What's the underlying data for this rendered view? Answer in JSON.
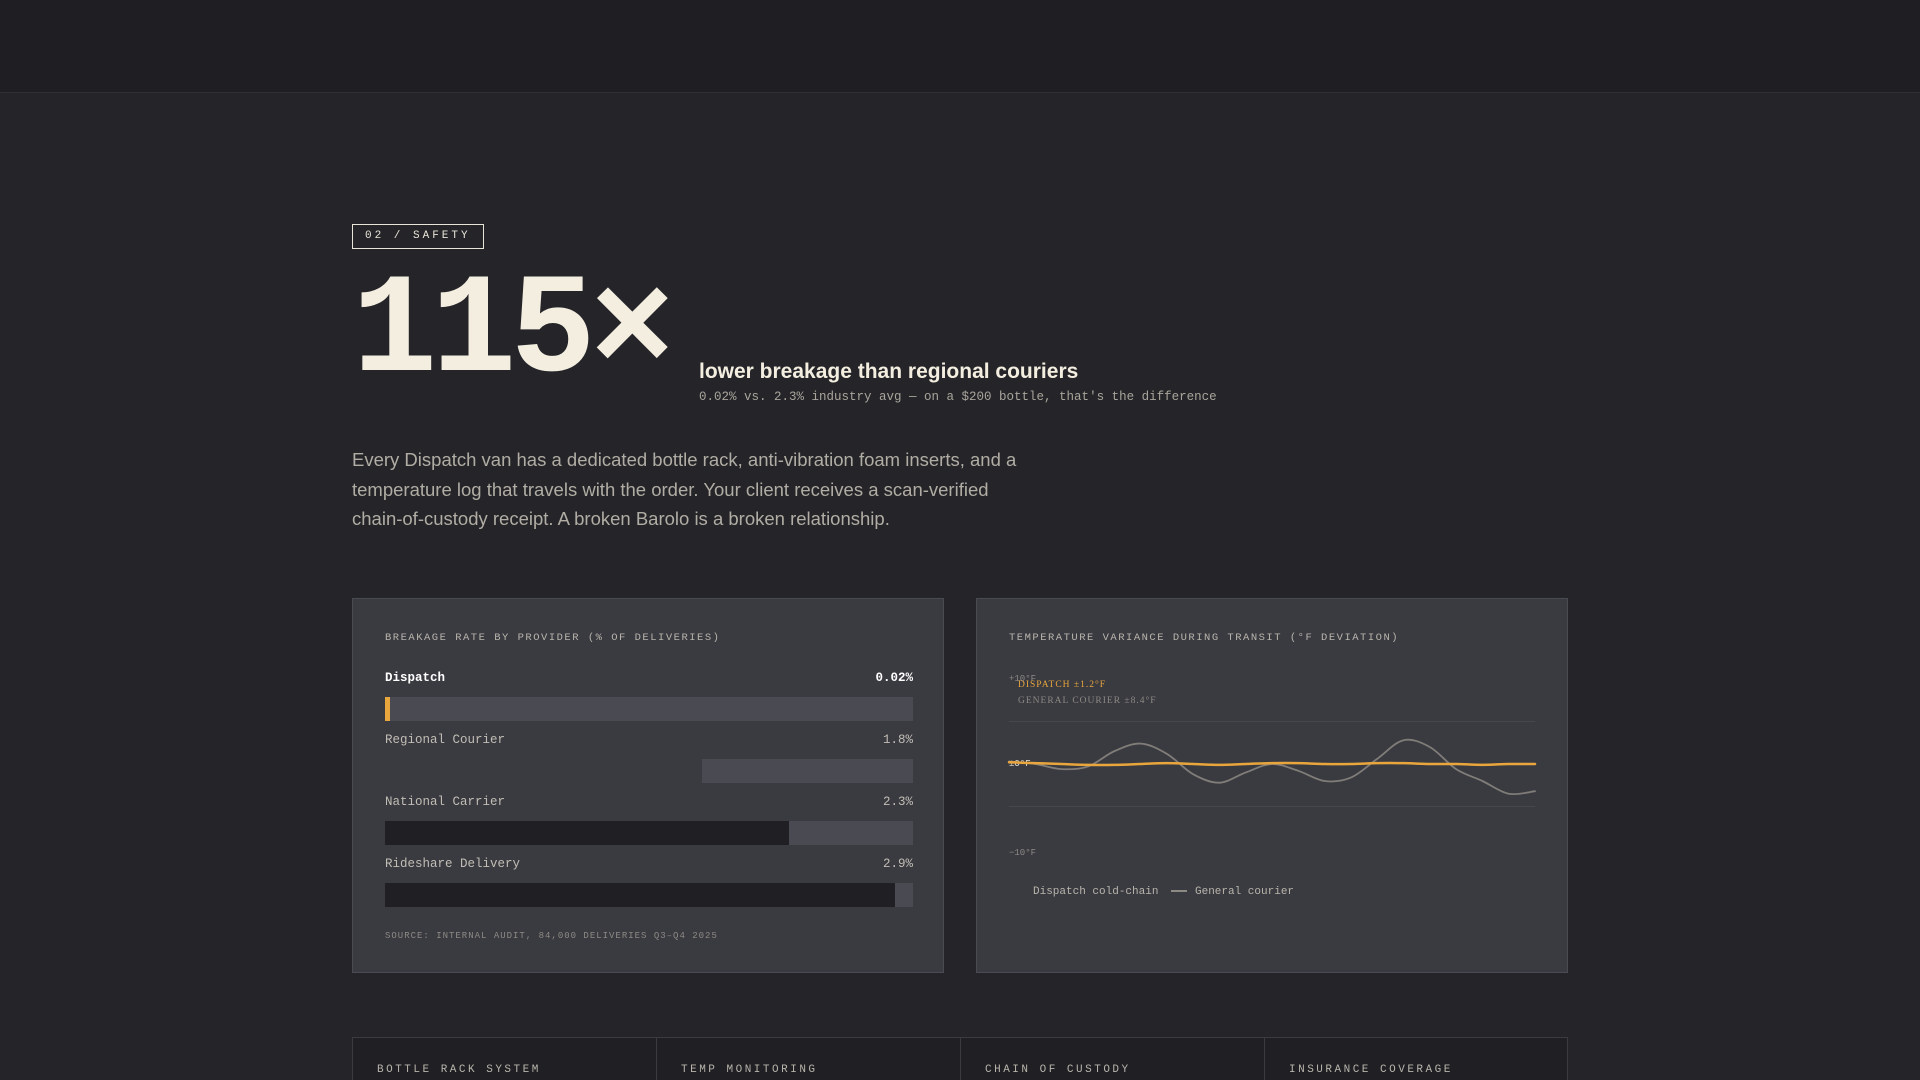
{
  "section": {
    "tag": "02 / SAFETY"
  },
  "headline": {
    "number": "115×",
    "subtitle": "lower breakage than regional couriers",
    "note": "0.02% vs. 2.3% industry avg — on a $200 bottle, that's the difference"
  },
  "intro": "Every Dispatch van has a dedicated bottle rack, anti-vibration foam inserts, and a temperature log that travels with the order. Your client receives a scan-verified chain-of-custody receipt. A broken Barolo is a broken relationship.",
  "breakage_card": {
    "title": "BREAKAGE RATE BY PROVIDER (% OF DELIVERIES)",
    "source": "SOURCE: INTERNAL AUDIT, 84,000 DELIVERIES Q3–Q4 2025",
    "rows": [
      {
        "label": "Dispatch",
        "value_label": "0.02%",
        "fill": 0.01,
        "align": "left"
      },
      {
        "label": "Regional Courier",
        "value_label": "1.8%",
        "fill": 0.6,
        "align": "none"
      },
      {
        "label": "National Carrier",
        "value_label": "2.3%",
        "fill": 0.766,
        "align": "left"
      },
      {
        "label": "Rideshare Delivery",
        "value_label": "2.9%",
        "fill": 0.966,
        "align": "left"
      }
    ]
  },
  "temperature_card": {
    "title": "TEMPERATURE VARIANCE DURING TRANSIT (°F DEVIATION)",
    "legend": [
      {
        "label": "Dispatch cold-chain",
        "color": "#e9a63c"
      },
      {
        "label": "General courier",
        "color": "#8d8a83"
      }
    ]
  },
  "chart_data": {
    "type": "line",
    "title": "TEMPERATURE VARIANCE DURING TRANSIT (°F DEVIATION)",
    "ylim": [
      -10,
      10
    ],
    "y_ticks": [
      "+10°F",
      "±0°F",
      "−10°F"
    ],
    "annotations": [
      "DISPATCH ±1.2°F",
      "GENERAL COURIER ±8.4°F"
    ],
    "x": [
      0,
      1,
      2,
      3,
      4,
      5,
      6,
      7,
      8,
      9,
      10,
      11,
      12,
      13,
      14,
      15,
      16,
      17,
      18,
      19,
      20
    ],
    "series": [
      {
        "name": "Dispatch cold-chain",
        "color": "#e9a63c",
        "values": [
          0.2,
          0.1,
          0,
          -0.1,
          -0.1,
          0,
          0.1,
          0,
          -0.1,
          0,
          0.1,
          0.1,
          0,
          0,
          0.1,
          0.1,
          0,
          0,
          -0.1,
          0,
          0
        ]
      },
      {
        "name": "General courier",
        "color": "#8d8a83",
        "values": [
          0.3,
          0,
          -0.6,
          -0.3,
          1.5,
          2.4,
          1.2,
          -1.2,
          -2.2,
          -1.0,
          0,
          -0.8,
          -2.0,
          -1.6,
          0.6,
          2.8,
          2.0,
          -0.6,
          -2.0,
          -3.5,
          -3.2
        ]
      }
    ]
  },
  "features": [
    {
      "title": "BOTTLE RACK SYSTEM"
    },
    {
      "title": "TEMP MONITORING"
    },
    {
      "title": "CHAIN OF CUSTODY"
    },
    {
      "title": "INSURANCE COVERAGE"
    }
  ],
  "colors": {
    "accent": "#e9a63c",
    "background": "#252529",
    "card": "#3a3a41"
  }
}
